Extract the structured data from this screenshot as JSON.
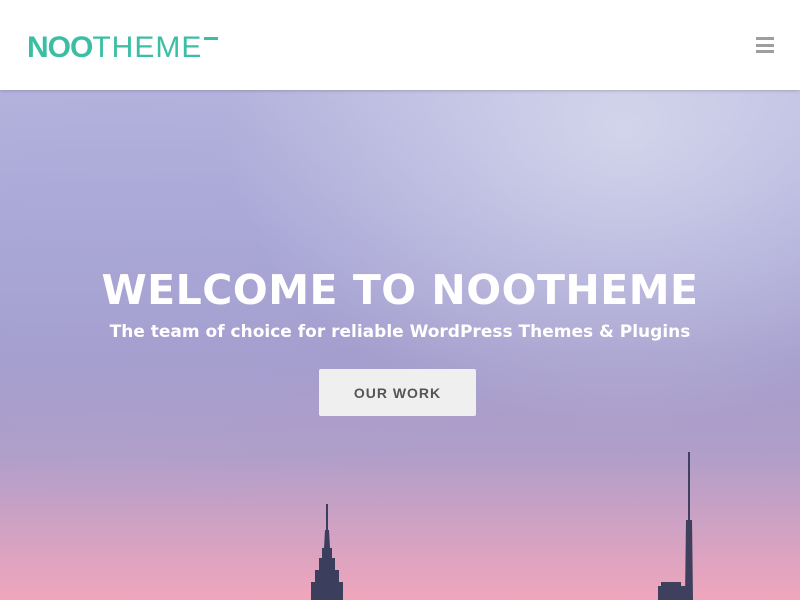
{
  "header": {
    "logo": {
      "part_bold": "NOO",
      "part_light": "THEME"
    },
    "menu_icon": "hamburger-menu-icon"
  },
  "hero": {
    "title": "WELCOME TO NOOTHEME",
    "subtitle": "The team of choice for reliable WordPress Themes & Plugins",
    "cta_label": "OUR WORK"
  },
  "colors": {
    "brand": "#3bbea3",
    "header_bg": "#ffffff",
    "menu_icon": "#9e9e9e",
    "button_bg": "#efefef",
    "button_text": "#555555",
    "hero_text": "#ffffff",
    "sky_top": "#b7b6df",
    "sky_bottom": "#f0a6bc"
  }
}
